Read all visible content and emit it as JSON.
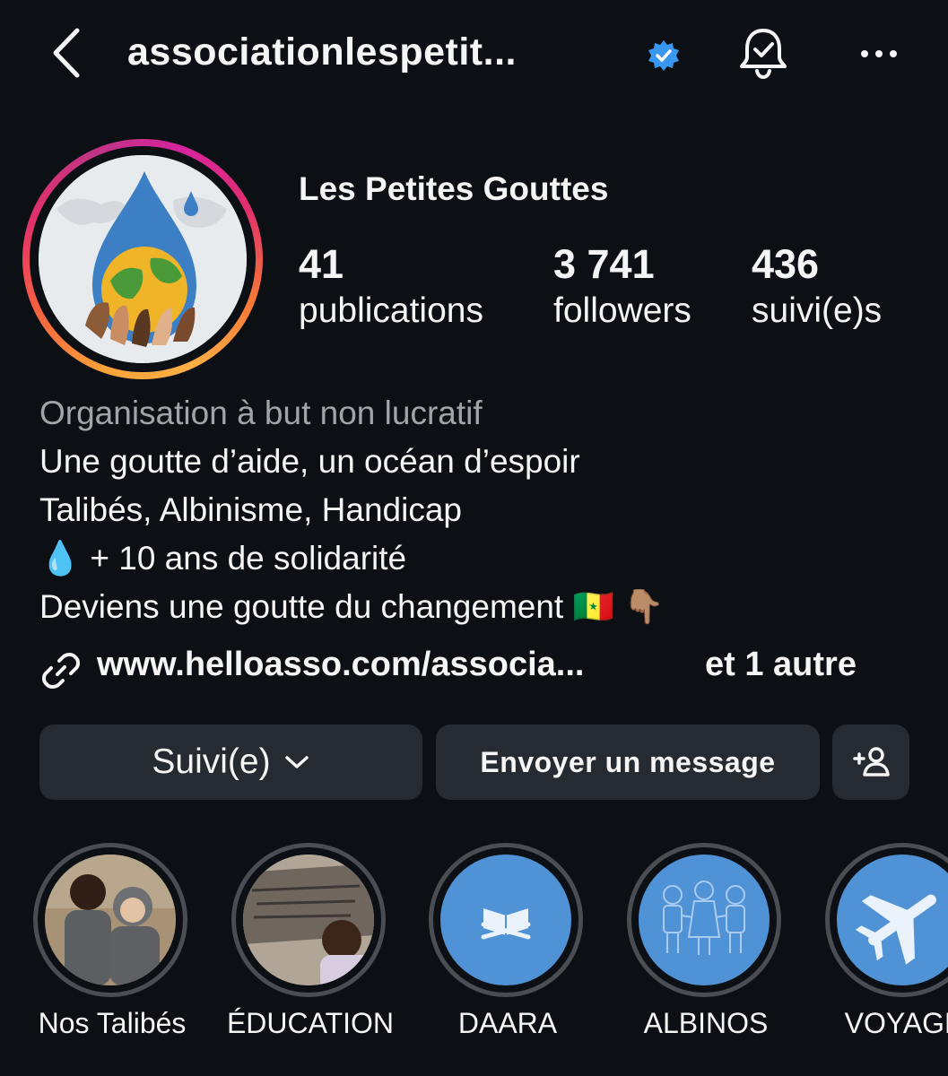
{
  "header": {
    "username": "associationlespetit...",
    "back_icon": "chevron-left-icon",
    "verified_icon": "verified-badge-icon",
    "notify_icon": "bell-check-icon",
    "more_icon": "more-horizontal-icon",
    "verified_color": "#3897f0"
  },
  "profile": {
    "display_name": "Les Petites Gouttes",
    "stats": [
      {
        "value": "41",
        "label": "publications"
      },
      {
        "value": "3 741",
        "label": "followers"
      },
      {
        "value": "436",
        "label": "suivi(e)s"
      }
    ],
    "category": "Organisation à but non lucratif",
    "bio_lines": [
      "Une goutte d’aide, un océan d’espoir",
      "Talibés, Albinisme, Handicap",
      "💧 + 10 ans de solidarité",
      "Deviens une goutte du changement 🇸🇳 👇🏽"
    ],
    "link_text": "www.helloasso.com/associa...",
    "link_more": "et 1 autre"
  },
  "actions": {
    "follow_label": "Suivi(e)",
    "message_label": "Envoyer un message",
    "add_icon": "add-person-icon"
  },
  "highlights": [
    {
      "label": "Nos Talibés",
      "icon": "photo"
    },
    {
      "label": "ÉDUCATION",
      "icon": "photo"
    },
    {
      "label": "DAARA",
      "icon": "open-book-icon"
    },
    {
      "label": "ALBINOS",
      "icon": "children-holding-hands-icon"
    },
    {
      "label": "VOYAGE",
      "icon": "airplane-icon"
    }
  ]
}
